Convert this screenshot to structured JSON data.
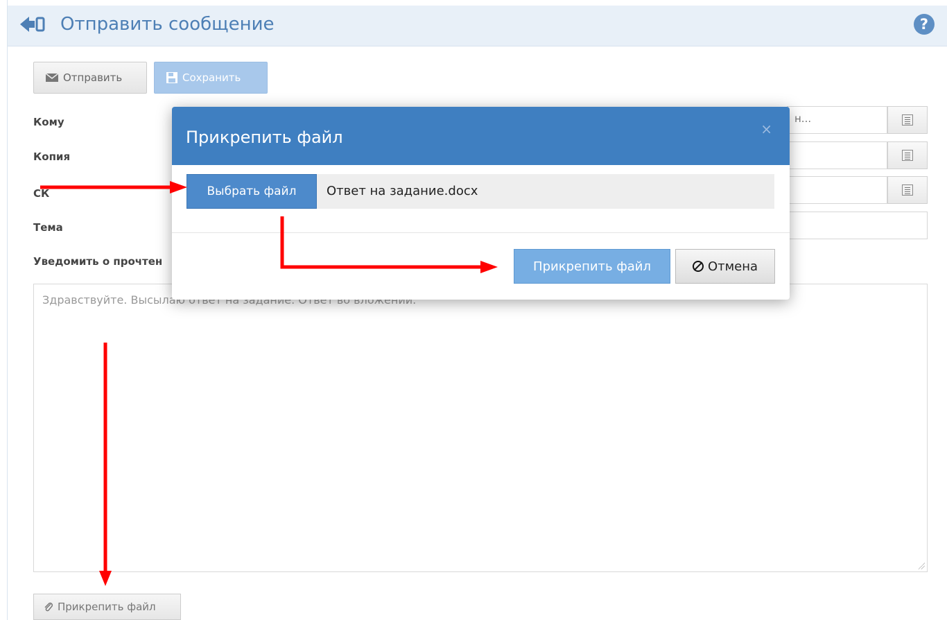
{
  "header": {
    "title": "Отправить сообщение",
    "back_icon": "back-arrow-icon",
    "help_label": "?"
  },
  "toolbar": {
    "send_label": "Отправить",
    "save_label": "Сохранить",
    "send_icon": "envelope-icon",
    "save_icon": "floppy-icon"
  },
  "form": {
    "to_label": "Кому",
    "cc_label": "Копия",
    "bcc_label": "СК",
    "subject_label": "Тема",
    "notify_label": "Уведомить о прочтен",
    "to_value_fragment": "н...",
    "body_text": "Здравствуйте. Высылаю ответ на задание. Ответ во вложении."
  },
  "bottom": {
    "attach_label": "Прикрепить файл"
  },
  "modal": {
    "title": "Прикрепить файл",
    "close_label": "×",
    "choose_label": "Выбрать файл",
    "file_name": "Ответ на задание.docx",
    "attach_label": "Прикрепить файл",
    "cancel_label": "Отмена"
  },
  "colors": {
    "modal_header": "#3f7fc1",
    "header_bg": "#e8f0f8",
    "arrow": "#ff0000"
  }
}
